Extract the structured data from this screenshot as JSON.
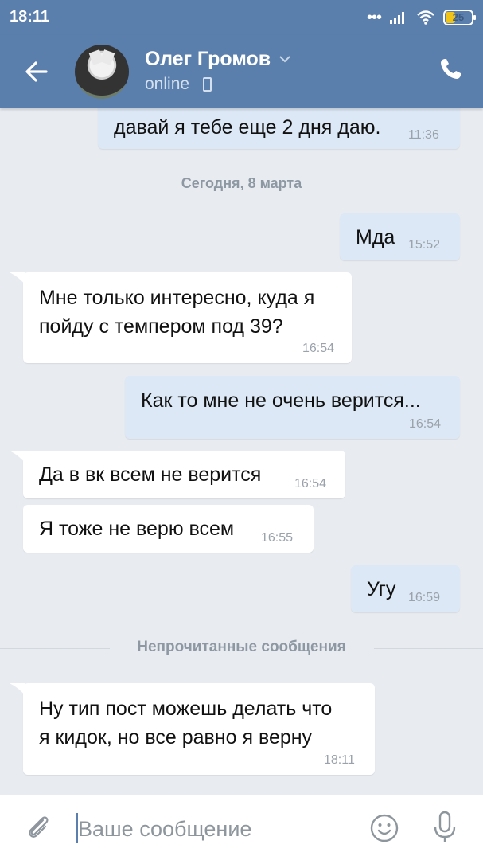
{
  "status_bar": {
    "time": "18:11",
    "battery": "25"
  },
  "header": {
    "contact_name": "Олег Громов",
    "status": "online"
  },
  "date_separator": "Сегодня, 8 марта",
  "unread_separator": "Непрочитанные сообщения",
  "messages": [
    {
      "direction": "out",
      "lines": [
        "давай я тебе еще 2 дня даю."
      ],
      "time": "11:36"
    },
    {
      "direction": "out",
      "lines": [
        "Мда"
      ],
      "time": "15:52"
    },
    {
      "direction": "in",
      "lines": [
        "Мне только интересно, куда я",
        "пойду с темпером под 39?"
      ],
      "time": "16:54"
    },
    {
      "direction": "out",
      "lines": [
        "Как то мне не очень верится..."
      ],
      "time": "16:54"
    },
    {
      "direction": "in",
      "lines": [
        "Да в вк всем не верится"
      ],
      "time": "16:54"
    },
    {
      "direction": "in",
      "lines": [
        "Я тоже не верю всем"
      ],
      "time": "16:55"
    },
    {
      "direction": "out",
      "lines": [
        "Угу"
      ],
      "time": "16:59"
    },
    {
      "direction": "in",
      "lines": [
        "Ну тип пост можешь делать что",
        "я кидок, но все равно я верну"
      ],
      "time": "18:11"
    }
  ],
  "composer": {
    "placeholder": "Ваше сообщение"
  },
  "colors": {
    "header": "#5a7fad",
    "incoming": "#ffffff",
    "outgoing": "#dce8f5",
    "background": "#e8ecf1"
  },
  "icons": [
    "back-arrow-icon",
    "chevron-down-icon",
    "phone-device-icon",
    "call-icon",
    "attach-icon",
    "emoji-icon",
    "microphone-icon",
    "signal-icon",
    "wifi-icon",
    "battery-icon"
  ]
}
